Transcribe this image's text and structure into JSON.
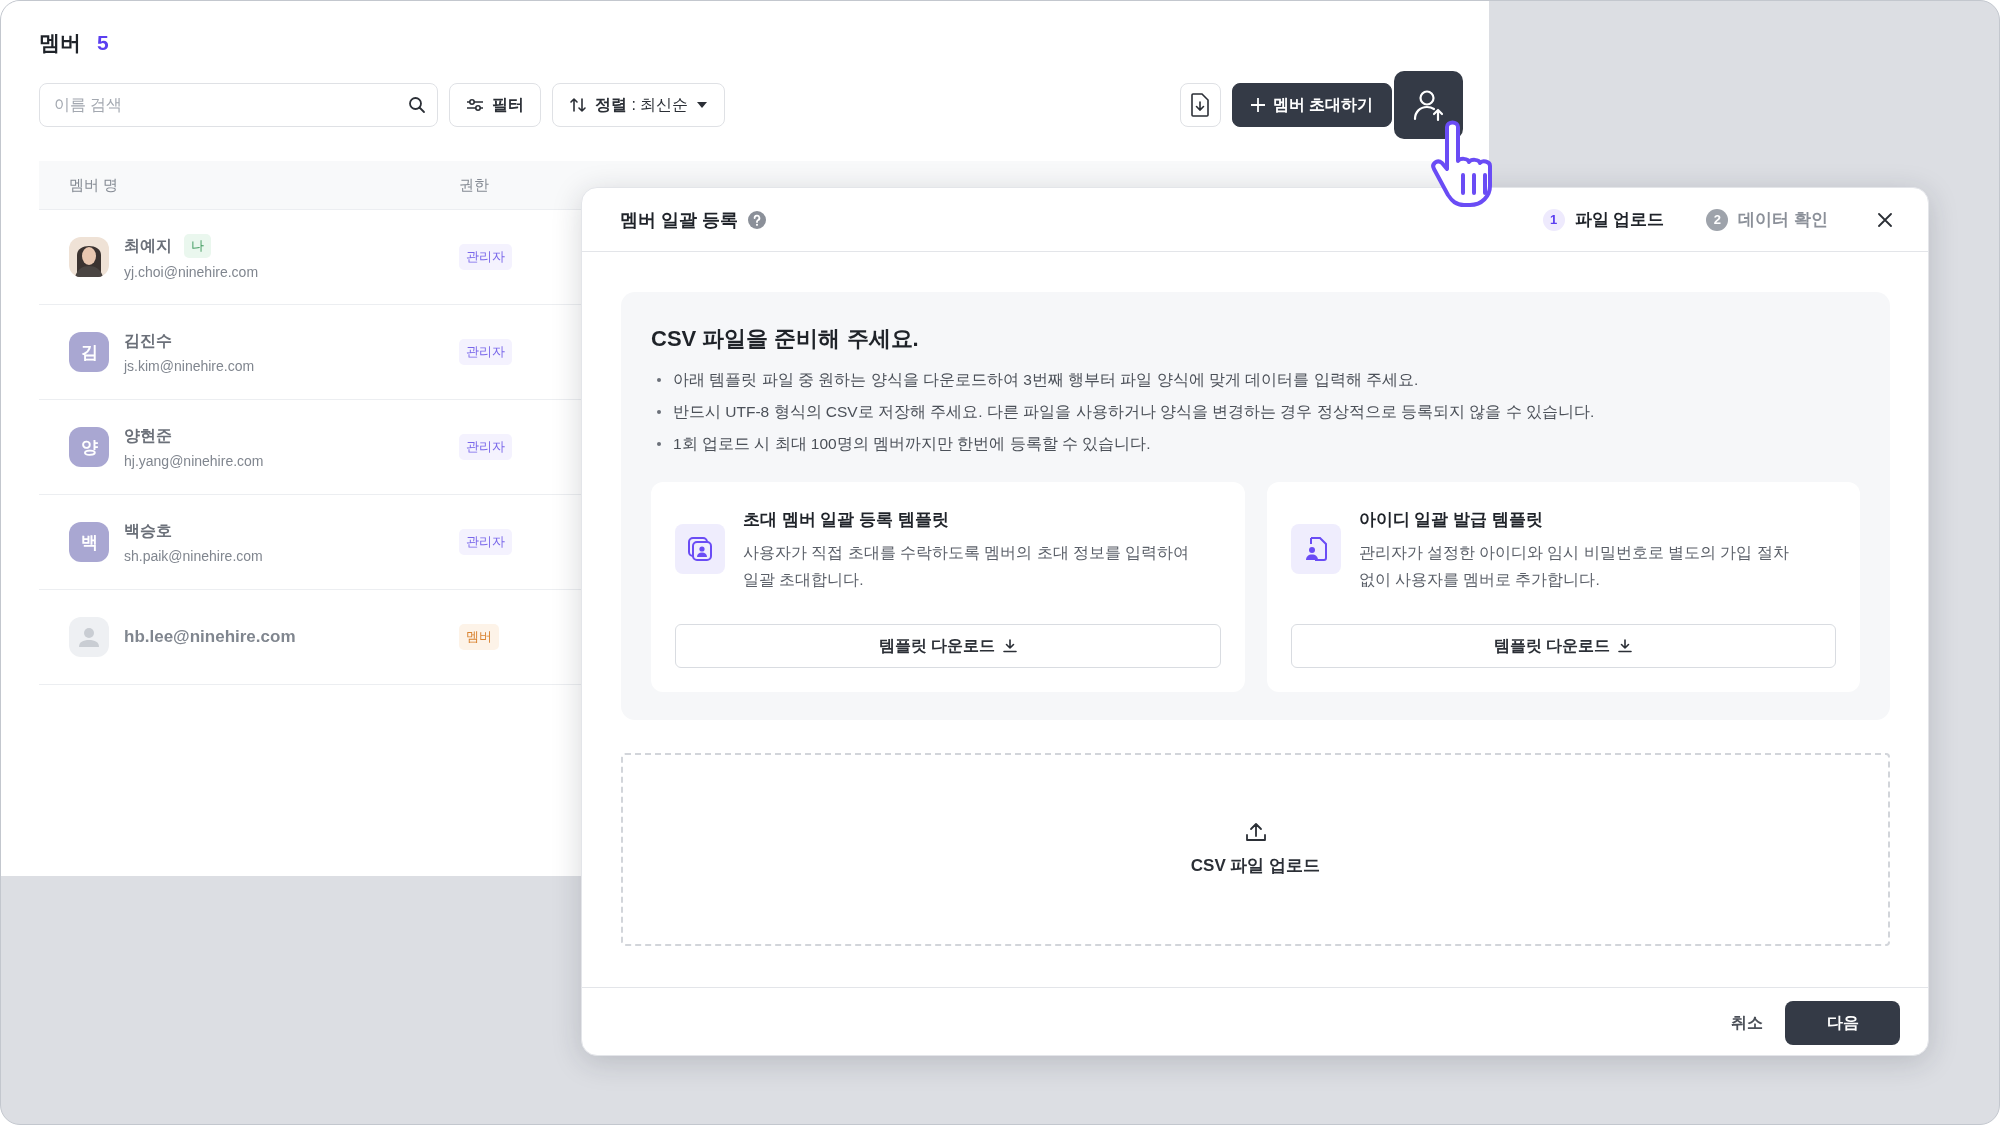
{
  "page": {
    "title": "멤버",
    "count": "5"
  },
  "toolbar": {
    "search": {
      "placeholder": "이름 검색"
    },
    "filter": "필터",
    "sort": "**정렬** : 최신순",
    "invite": "멤버 초대하기"
  },
  "table": {
    "columns": [
      "멤버 명",
      "권한"
    ],
    "rows": [
      {
        "name": "최예지",
        "me_badge": "나",
        "email": "yj.choi@ninehire.com",
        "role": {
          "label": "관리자",
          "kind": "admin"
        }
      },
      {
        "avatar": {
          "kind": "initial",
          "text": "김"
        },
        "name": "김진수",
        "email": "js.kim@ninehire.com",
        "role": {
          "label": "관리자",
          "kind": "admin"
        }
      },
      {
        "avatar": {
          "kind": "initial",
          "text": "양"
        },
        "name": "양현준",
        "email": "hj.yang@ninehire.com",
        "role": {
          "label": "관리자",
          "kind": "admin"
        }
      },
      {
        "avatar": {
          "kind": "initial",
          "text": "백"
        },
        "name": "백승호",
        "email": "sh.paik@ninehire.com",
        "role": {
          "label": "관리자",
          "kind": "admin"
        }
      },
      {
        "avatar": {
          "kind": "placeholder"
        },
        "email": "hb.lee@ninehire.com",
        "role": {
          "label": "멤버",
          "kind": "member"
        }
      }
    ]
  },
  "modal": {
    "title": "멤버 일괄 등록",
    "steps": [
      {
        "number": "1",
        "label": "파일 업로드",
        "selected": true
      },
      {
        "number": "2",
        "label": "데이터 확인",
        "selected": false
      }
    ],
    "guide": {
      "title": "CSV 파일을 준비해 주세요.",
      "bullets": [
        "아래 템플릿 파일 중 원하는 양식을 다운로드하여 3번째 행부터 파일 양식에 맞게 데이터를 입력해 주세요.",
        "반드시 UTF-8 형식의 CSV로 저장해 주세요. 다른 파일을 사용하거나 양식을 변경하는 경우 정상적으로 등록되지 않을 수 있습니다.",
        "1회 업로드 시 최대 100명의 멤버까지만 한번에 등록할 수 있습니다."
      ]
    },
    "templates": [
      {
        "kind": "invite",
        "title": "초대 멤버 일괄 등록 템플릿",
        "description": "사용자가 직접 초대를 수락하도록 멤버의 초대 정보를 입력하여 일괄 초대합니다.",
        "button": "템플릿 다운로드"
      },
      {
        "kind": "id",
        "title": "아이디 일괄 발급 템플릿",
        "description": "관리자가 설정한 아이디와 임시 비밀번호로 별도의 가입 절차 없이 사용자를 멤버로 추가합니다.",
        "button": "템플릿 다운로드"
      }
    ],
    "upload": {
      "label": "CSV 파일 업로드"
    },
    "buttons": {
      "cancel": "취소",
      "next": "다음"
    }
  }
}
